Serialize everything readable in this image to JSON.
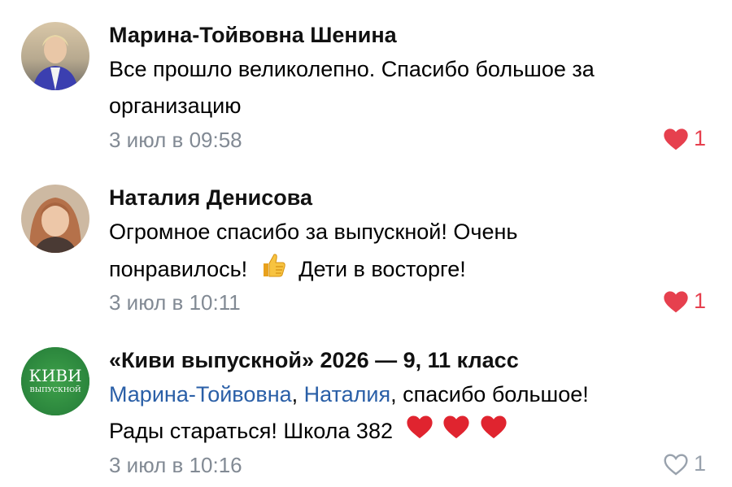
{
  "colors": {
    "accent_link": "#2a5fa7",
    "meta_gray": "#828a94",
    "like_red": "#e6404e",
    "like_inactive": "#99a2ad"
  },
  "comments": [
    {
      "author": "Марина-Тойвовна Шенина",
      "text_line1": "Все прошло великолепно. Спасибо большое за",
      "text_line2": "организацию",
      "time": "3 июл в 09:58",
      "likes": "1",
      "liked": true,
      "avatar_icon": "user-photo-avatar"
    },
    {
      "author": "Наталия Денисова",
      "text_line1": "Огромное спасибо за выпускной! Очень",
      "text_line2_before": "понравилось!",
      "text_line2_emoji": "thumbs-up-icon",
      "text_line2_after": "Дети в восторге!",
      "time": "3 июл в 10:11",
      "likes": "1",
      "liked": true,
      "avatar_icon": "user-photo-avatar"
    },
    {
      "author": "«Киви выпускной» 2026  — 9, 11 класс",
      "mention1": "Марина-Тойвовна",
      "separator": ", ",
      "mention2": "Наталия",
      "text_after_mentions": ", спасибо большое!",
      "text_line2": "Рады стараться! Школа 382",
      "text_line2_emoji": "heart-emoji-icon",
      "time": "3 июл в 10:16",
      "likes": "1",
      "liked": false,
      "avatar_logo_line1": "КИВИ",
      "avatar_logo_line2": "ВЫПУСКНОЙ"
    }
  ]
}
